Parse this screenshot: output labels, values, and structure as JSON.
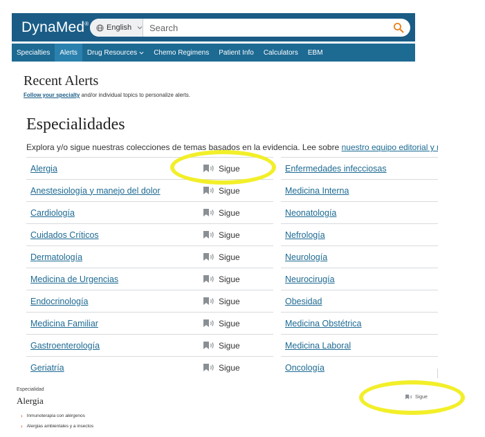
{
  "app": {
    "logo": "DynaMed",
    "logo_mark": "®"
  },
  "search": {
    "language": "English",
    "placeholder": "Search"
  },
  "nav": {
    "items": [
      {
        "label": "Specialties",
        "active": false
      },
      {
        "label": "Alerts",
        "active": true
      },
      {
        "label": "Drug Resources",
        "active": false,
        "dropdown": true
      },
      {
        "label": "Chemo Regimens",
        "active": false
      },
      {
        "label": "Patient Info",
        "active": false
      },
      {
        "label": "Calculators",
        "active": false
      },
      {
        "label": "EBM",
        "active": false
      }
    ]
  },
  "recent_alerts": {
    "title": "Recent Alerts",
    "link_text": "Follow your specialty",
    "rest_text": " and/or individual topics to personalize alerts."
  },
  "specialties_page": {
    "title": "Especialidades",
    "description": "Explora y/o sigue nuestras colecciones de temas basados en la evidencia. Lee sobre ",
    "description_link": "nuestro equipo editorial y nuestro",
    "follow_label": "Sigue",
    "left_column": [
      "Alergia",
      "Anestesiología y manejo del dolor",
      "Cardiología",
      "Cuidados Críticos",
      "Dermatología",
      "Medicina de Urgencias",
      "Endocrinología",
      "Medicina Familiar",
      "Gastroenterología",
      "Geriatría"
    ],
    "right_column": [
      "Enfermedades infecciosas",
      "Medicina Interna",
      "Neonatología",
      "Nefrología",
      "Neurología",
      "Neurocirugía",
      "Obesidad",
      "Medicina Obstétrica",
      "Medicina Laboral",
      "Oncología"
    ]
  },
  "detail": {
    "label": "Especialidad",
    "title": "Alergia",
    "follow_label": "Sigue",
    "items": [
      "Inmunoterapia con alérgenos",
      "Alergias ambientales y a insectos"
    ]
  },
  "colors": {
    "header": "#1a5c86",
    "nav": "#1d6a93",
    "link": "#1d6a93",
    "highlight": "#f2ef2a",
    "chevron": "#d9480f"
  },
  "icons": {
    "globe": "globe-icon",
    "chevron": "chevron-down-icon",
    "search": "search-icon",
    "follow": "bookmark-sound-icon",
    "arrow": "chevron-right-icon"
  }
}
